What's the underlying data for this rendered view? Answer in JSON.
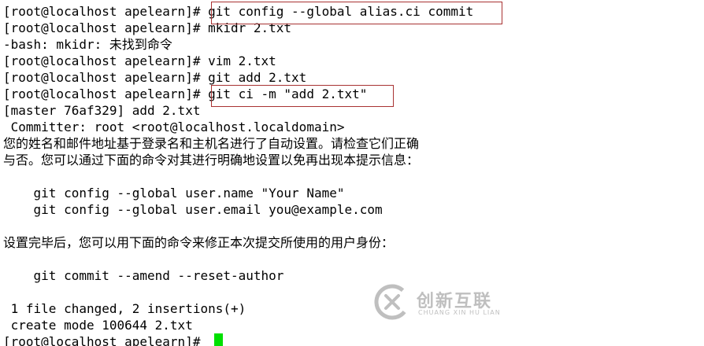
{
  "terminal": {
    "lines": [
      "[root@localhost apelearn]# git config --global alias.ci commit",
      "[root@localhost apelearn]# mkidr 2.txt",
      "-bash: mkidr: 未找到命令",
      "[root@localhost apelearn]# vim 2.txt",
      "[root@localhost apelearn]# git add 2.txt",
      "[root@localhost apelearn]# git ci -m \"add 2.txt\"",
      "[master 76af329] add 2.txt",
      " Committer: root <root@localhost.localdomain>",
      "您的姓名和邮件地址基于登录名和主机名进行了自动设置。请检查它们正确",
      "与否。您可以通过下面的命令对其进行明确地设置以免再出现本提示信息：",
      "",
      "    git config --global user.name \"Your Name\"",
      "    git config --global user.email you@example.com",
      "",
      "设置完毕后，您可以用下面的命令来修正本次提交所使用的用户身份：",
      "",
      "    git commit --amend --reset-author",
      "",
      " 1 file changed, 2 insertions(+)",
      " create mode 100644 2.txt",
      "[root@localhost apelearn]# "
    ],
    "cursor_color": "#00e000",
    "highlight_color": "#a83232"
  },
  "watermark": {
    "icon": "brand-logo-icon",
    "text": "创新互联",
    "subtext": "CHUANG XIN HU LIAN"
  }
}
